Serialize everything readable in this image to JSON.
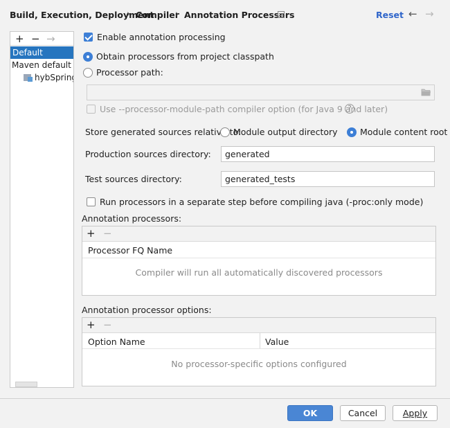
{
  "header": {
    "breadcrumb": [
      "Build, Execution, Deployment",
      "Compiler",
      "Annotation Processors"
    ],
    "separator": "›",
    "reset_label": "Reset",
    "back_arrow": "←",
    "forward_arrow": "→"
  },
  "left_panel": {
    "add": "+",
    "remove": "−",
    "move": "→",
    "items": [
      "Default",
      "Maven default an",
      "hybSpringC"
    ]
  },
  "options": {
    "enable_annotation_processing": "Enable annotation processing",
    "obtain_from_classpath": "Obtain processors from project classpath",
    "processor_path": "Processor path:",
    "processor_path_value": "",
    "use_module_path": "Use --processor-module-path compiler option (for Java 9 and later)",
    "help": "?",
    "store_generated_label": "Store generated sources relative to:",
    "module_output_directory": "Module output directory",
    "module_content_root": "Module content root",
    "production_sources_label": "Production sources directory:",
    "production_sources_value": "generated",
    "test_sources_label": "Test sources directory:",
    "test_sources_value": "generated_tests",
    "run_separate_step": "Run processors in a separate step before compiling java (-proc:only mode)"
  },
  "annotation_processors": {
    "title": "Annotation processors:",
    "add": "+",
    "remove": "−",
    "column": "Processor FQ Name",
    "empty_text": "Compiler will run all automatically discovered processors"
  },
  "processor_options": {
    "title": "Annotation processor options:",
    "add": "+",
    "remove": "−",
    "columns": [
      "Option Name",
      "Value"
    ],
    "empty_text": "No processor-specific options configured"
  },
  "footer": {
    "ok": "OK",
    "cancel": "Cancel",
    "apply": "Apply"
  },
  "colors": {
    "accent": "#3d7fd6",
    "selection": "#2675bf",
    "link": "#2f65ca"
  }
}
